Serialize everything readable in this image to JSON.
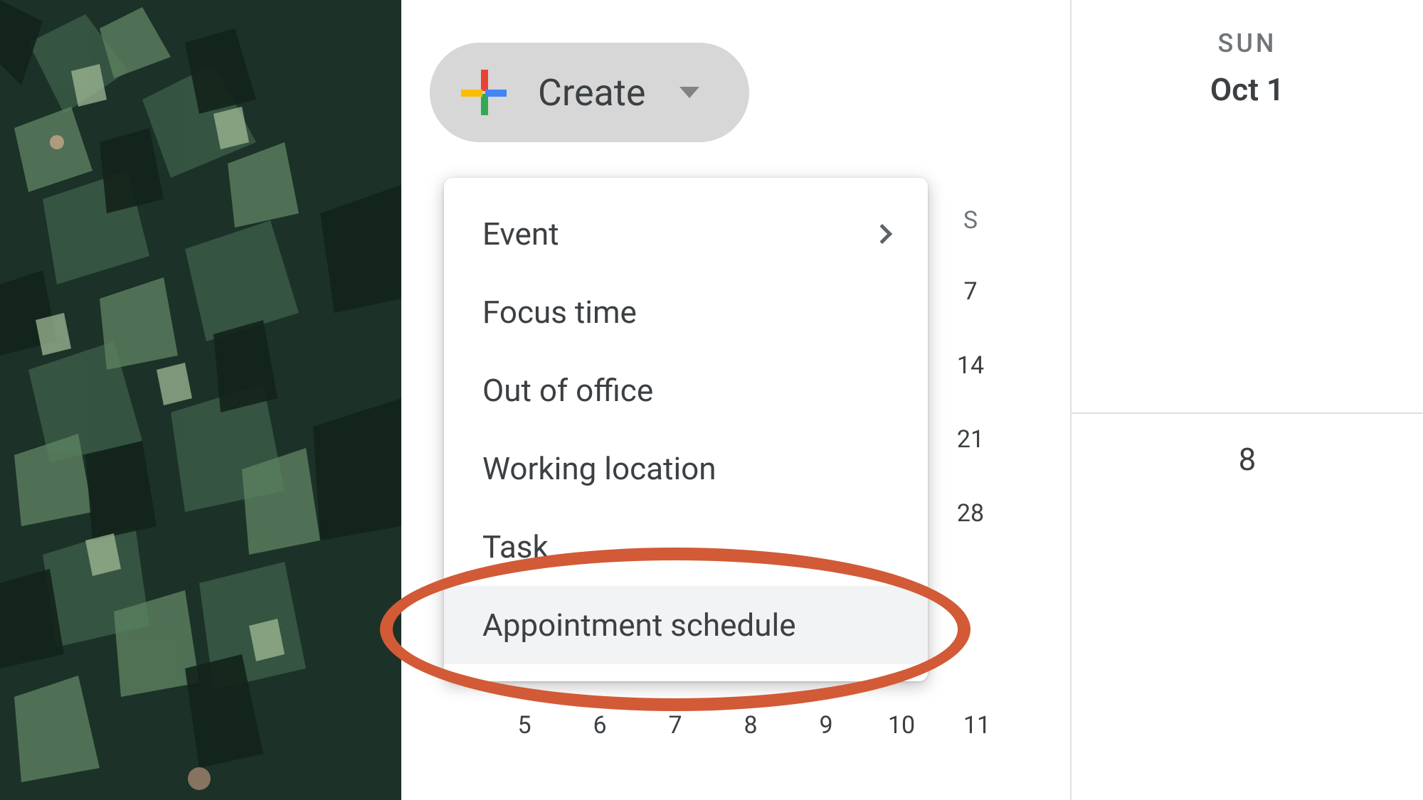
{
  "create_button": {
    "label": "Create"
  },
  "create_menu": {
    "items": [
      {
        "label": "Event",
        "has_submenu": true
      },
      {
        "label": "Focus time",
        "has_submenu": false
      },
      {
        "label": "Out of office",
        "has_submenu": false
      },
      {
        "label": "Working location",
        "has_submenu": false
      },
      {
        "label": "Task",
        "has_submenu": false
      },
      {
        "label": "Appointment schedule",
        "has_submenu": false
      }
    ]
  },
  "mini_calendar_peek": {
    "header": "S",
    "rows": [
      "7",
      "14",
      "21",
      "28"
    ]
  },
  "mini_calendar_bottom_row": [
    "5",
    "6",
    "7",
    "8",
    "9",
    "10",
    "11"
  ],
  "calendar_grid": {
    "columns": [
      {
        "weekday": "SUN",
        "date_label": "Oct 1",
        "next_week_date": "8"
      }
    ]
  },
  "annotation": {
    "highlighted_item": "Appointment schedule"
  }
}
